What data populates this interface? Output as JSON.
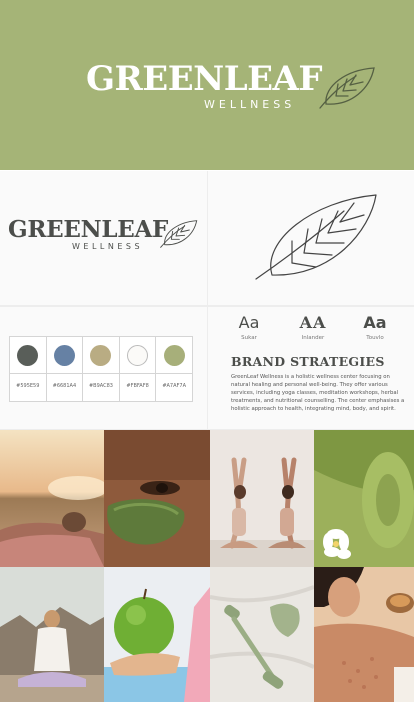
{
  "hero": {
    "brand_name": "GREENLEAF",
    "brand_sub": "WELLNESS",
    "background": "#A5B477"
  },
  "logo_panel": {
    "brand_name": "GREENLEAF",
    "brand_sub": "WELLNESS"
  },
  "palette": [
    {
      "hex": "#595E59",
      "color": "#595E59"
    },
    {
      "hex": "#6681A4",
      "color": "#6681A4"
    },
    {
      "hex": "#B9AC83",
      "color": "#B9AC83"
    },
    {
      "hex": "#FBFAF8",
      "color": "#FBFAF8"
    },
    {
      "hex": "#A7AF7A",
      "color": "#A7AF7A"
    }
  ],
  "fonts": [
    {
      "sample": "Aa",
      "name": "Sukar"
    },
    {
      "sample": "AA",
      "name": "Inlander"
    },
    {
      "sample": "Aa",
      "name": "Touvlo"
    }
  ],
  "brand": {
    "heading": "BRAND STRATEGIES",
    "body": "GreenLeaf Wellness is a holistic wellness center focusing on natural healing and personal well-being. They offer various services, including yoga classes, meditation workshops, herbal treatments, and nutritional counselling. The center emphasises a holistic approach to health, integrating mind, body, and spirit."
  },
  "photos": [
    "person-relaxing-on-beach-photo",
    "face-with-green-clay-mask-photo",
    "two-women-yoga-stretch-photo",
    "green-yoga-mat-with-flowers-photo",
    "woman-meditating-outdoors-photo",
    "hand-holding-green-apple-photo",
    "jade-face-roller-photo",
    "woman-spa-body-scrub-photo"
  ]
}
